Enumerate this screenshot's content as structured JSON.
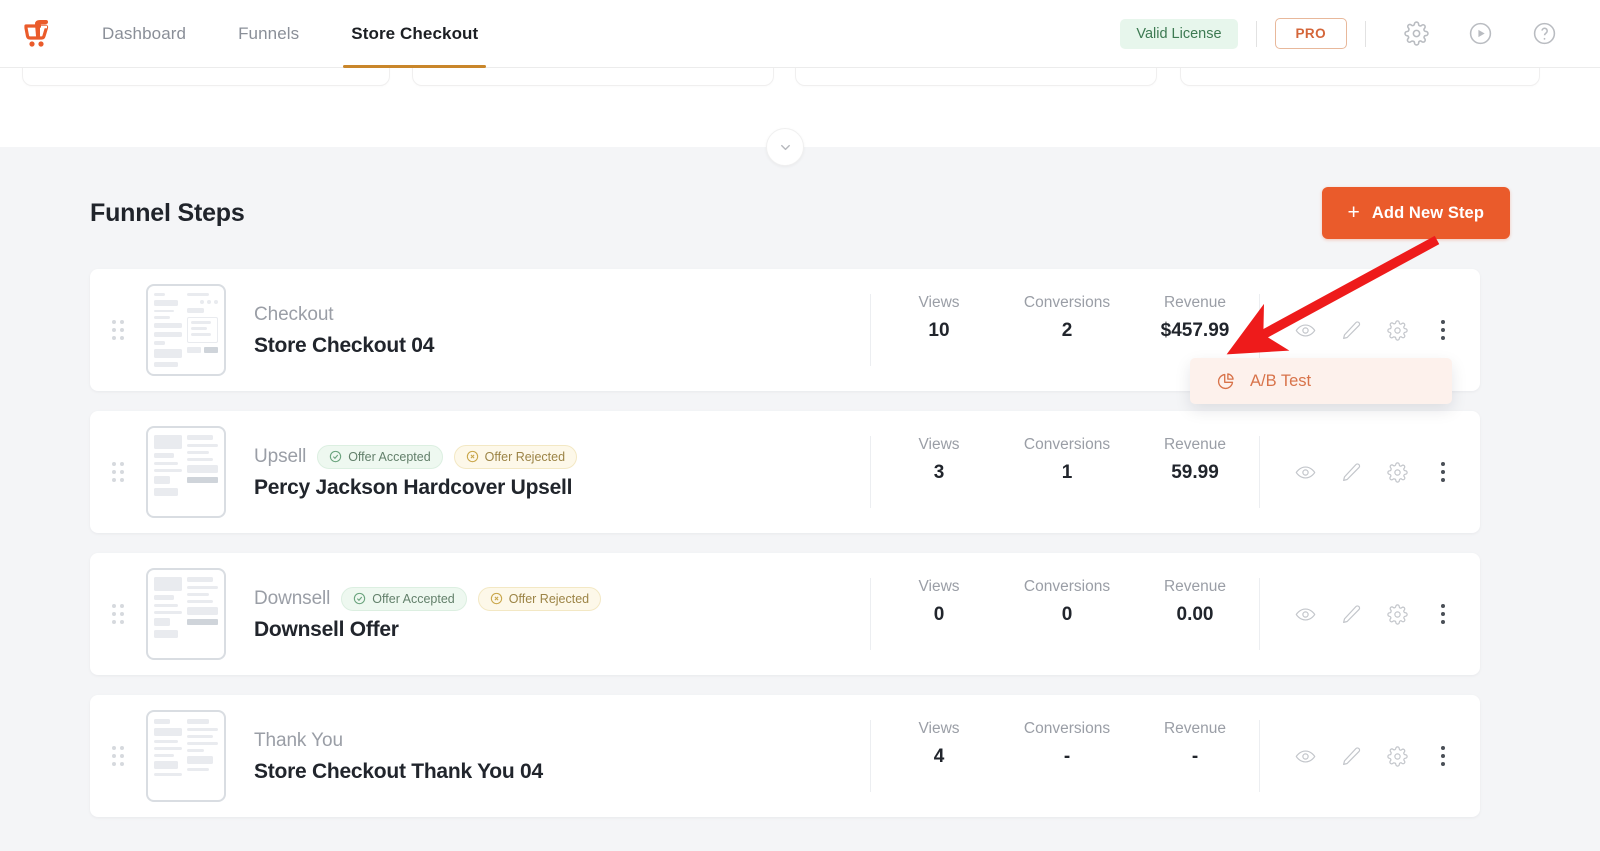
{
  "app": {
    "logo_name": "cartflows-logo",
    "accent_color": "#ea5b2b",
    "nav": [
      {
        "label": "Dashboard",
        "active": false
      },
      {
        "label": "Funnels",
        "active": false
      },
      {
        "label": "Store Checkout",
        "active": true
      }
    ],
    "top_right": {
      "license_badge": "Valid License",
      "pro_badge": "PRO",
      "icons": [
        "gear-icon",
        "play-circle-icon",
        "help-circle-icon"
      ]
    }
  },
  "collapse_toggle": {
    "icon": "chevron-down-icon"
  },
  "section": {
    "title": "Funnel Steps",
    "add_button": {
      "label": "Add New Step",
      "icon": "plus-icon"
    }
  },
  "stat_labels": {
    "views": "Views",
    "conversions": "Conversions",
    "revenue": "Revenue"
  },
  "steps": [
    {
      "type": "Checkout",
      "name": "Store Checkout 04",
      "chips": [],
      "views": "10",
      "conversions": "2",
      "revenue": "$457.99"
    },
    {
      "type": "Upsell",
      "name": "Percy Jackson Hardcover Upsell",
      "chips": [
        {
          "label": "Offer Accepted",
          "kind": "accept",
          "icon": "check-circle-icon"
        },
        {
          "label": "Offer Rejected",
          "kind": "reject",
          "icon": "x-circle-icon"
        }
      ],
      "views": "3",
      "conversions": "1",
      "revenue": "59.99"
    },
    {
      "type": "Downsell",
      "name": "Downsell Offer",
      "chips": [
        {
          "label": "Offer Accepted",
          "kind": "accept",
          "icon": "check-circle-icon"
        },
        {
          "label": "Offer Rejected",
          "kind": "reject",
          "icon": "x-circle-icon"
        }
      ],
      "views": "0",
      "conversions": "0",
      "revenue": "0.00"
    },
    {
      "type": "Thank You",
      "name": "Store Checkout Thank You 04",
      "chips": [],
      "views": "4",
      "conversions": "-",
      "revenue": "-"
    }
  ],
  "row_actions": [
    "eye-icon",
    "pencil-icon",
    "gear-icon",
    "kebab-menu-icon"
  ],
  "context_menu": {
    "open_for_step": "Store Checkout 04",
    "items": [
      {
        "label": "A/B Test",
        "icon": "pie-chart-icon",
        "color": "#d8734a"
      }
    ]
  },
  "annotation": {
    "type": "red-arrow",
    "points_to": "kebab-menu-icon",
    "color": "#ee1b1b"
  }
}
